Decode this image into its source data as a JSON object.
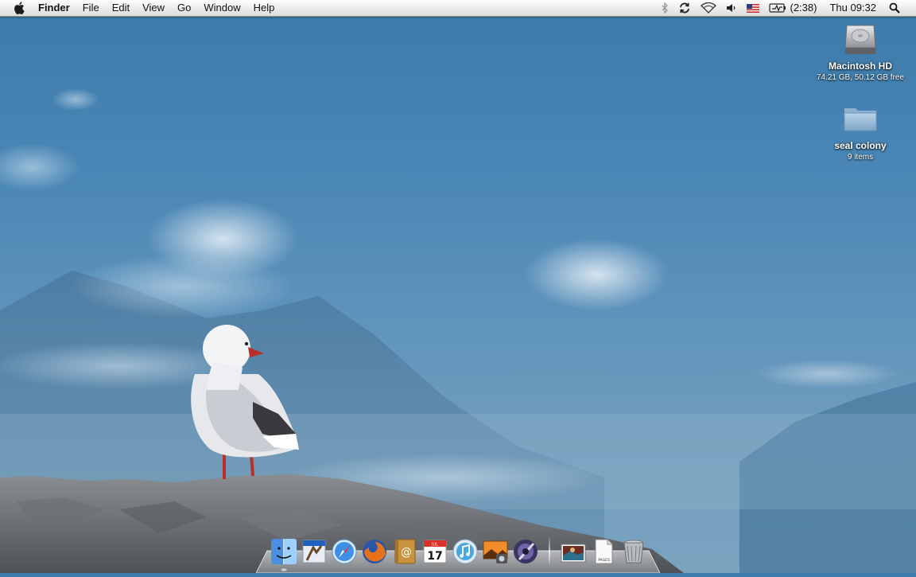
{
  "menubar": {
    "app_name": "Finder",
    "menus": [
      "File",
      "Edit",
      "View",
      "Go",
      "Window",
      "Help"
    ],
    "battery_time": "(2:38)",
    "clock": "Thu 09:32",
    "status_icons": [
      "bluetooth-icon",
      "sync-icon",
      "wifi-icon",
      "volume-icon",
      "us-flag-input-icon",
      "battery-icon",
      "spotlight-icon"
    ]
  },
  "desktop": {
    "icons": [
      {
        "name": "Macintosh HD",
        "sub": "74.21 GB, 50.12 GB free",
        "icon": "hard-drive-icon"
      },
      {
        "name": "seal colony",
        "sub": "9 items",
        "icon": "folder-icon"
      }
    ]
  },
  "dock": {
    "apps": [
      "finder-icon",
      "mail-icon",
      "safari-icon",
      "firefox-icon",
      "address-book-icon",
      "ical-icon",
      "itunes-icon",
      "iphoto-icon",
      "aperture-icon"
    ],
    "ical_day": "17",
    "ical_month": "JUL",
    "documents": [
      "photo-stack-icon",
      "pages-document-icon",
      "trash-icon"
    ],
    "pages_label": "PAGES"
  },
  "colors": {
    "sky": "#3c7aaa",
    "menubar": "#eeeeee",
    "folder": "#8fb6d6"
  }
}
